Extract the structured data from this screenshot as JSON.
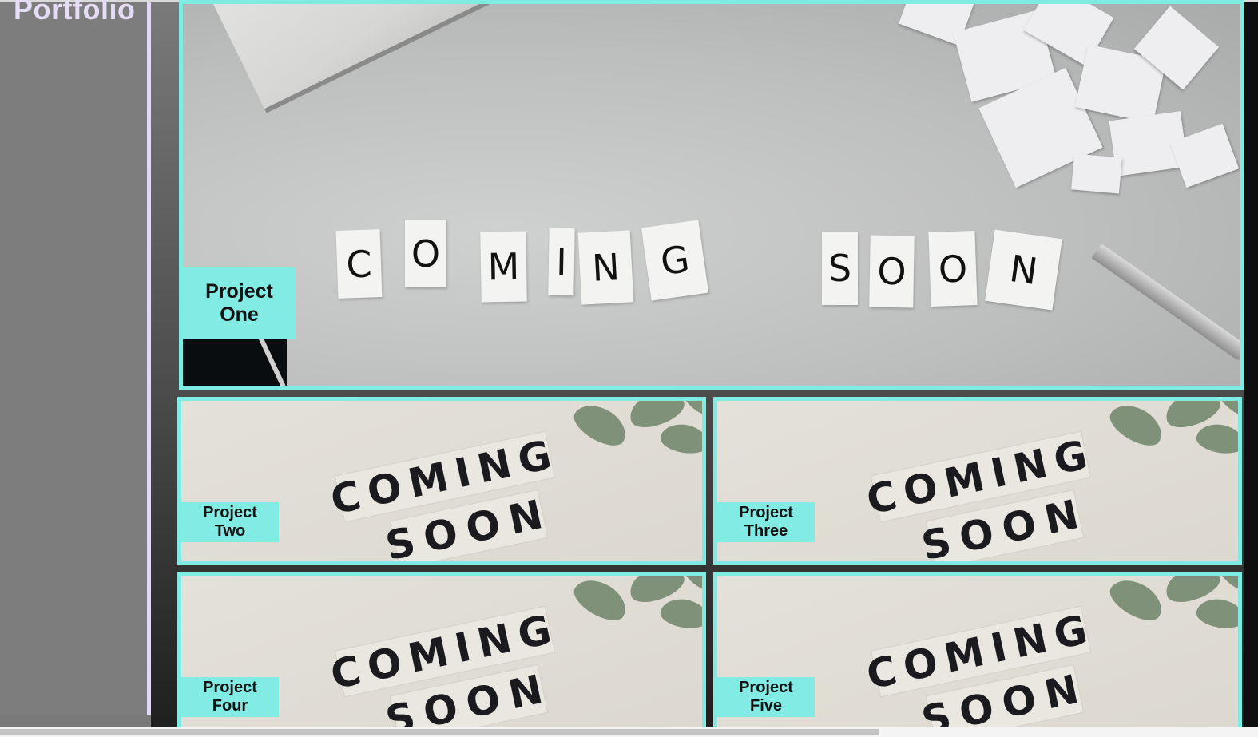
{
  "sidebar": {
    "title": "Portfolio"
  },
  "projects": [
    {
      "line1": "Project",
      "line2": "One"
    },
    {
      "line1": "Project",
      "line2": "Two"
    },
    {
      "line1": "Project",
      "line2": "Three"
    },
    {
      "line1": "Project",
      "line2": "Four"
    },
    {
      "line1": "Project",
      "line2": "Five"
    }
  ],
  "colors": {
    "accent": "#7eece2",
    "sidebar_title": "#e7dcf7"
  }
}
